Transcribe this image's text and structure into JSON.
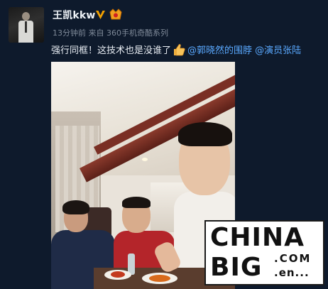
{
  "post": {
    "username": "王凯kkw",
    "time": "13分钟前",
    "source_prefix": "来自",
    "source": "360手机奇酷系列",
    "text_main": "强行同框！这技术也是没谁了",
    "mention1": "@郭晓然的围脖",
    "mention2": "@演员张陆"
  },
  "icons": {
    "avatar": "user-avatar",
    "verified": "verified-v-icon",
    "level": "member-level-icon",
    "thumbs_up": "thumbs-up-emoji"
  },
  "watermark": {
    "line1": "CHINA",
    "line2": "BIG",
    "com": ".COM",
    "en": ".en..."
  },
  "colors": {
    "background": "#0e1a2c",
    "mention": "#5aa9ff",
    "verified": "#f2a000"
  }
}
